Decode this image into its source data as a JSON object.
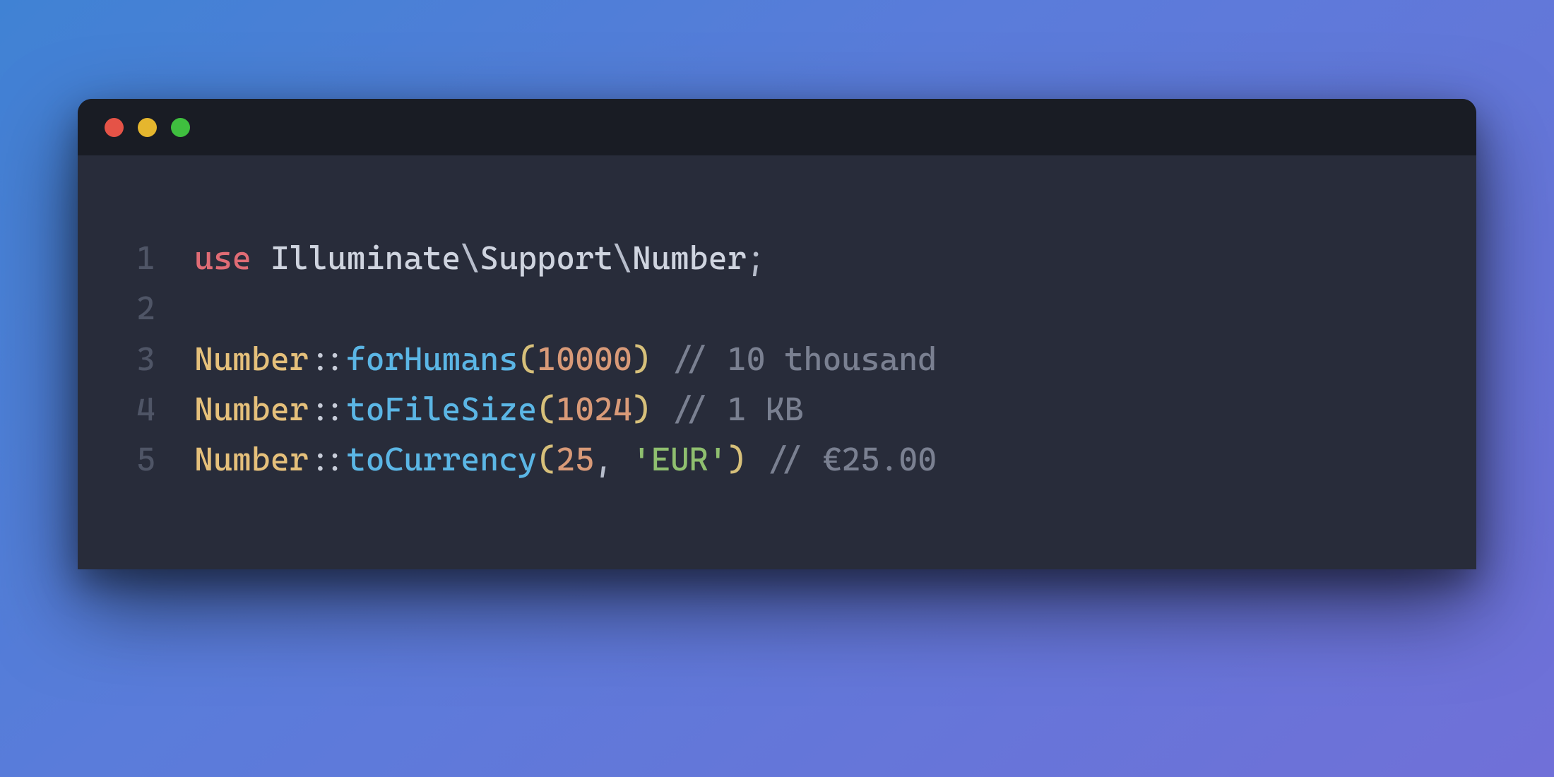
{
  "code": {
    "lines": [
      {
        "num": "1",
        "tokens": {
          "keyword": "use",
          "sp1": " ",
          "ns1": "Illuminate",
          "bs1": "\\",
          "ns2": "Support",
          "bs2": "\\",
          "ns3": "Number",
          "semi": ";"
        }
      },
      {
        "num": "2",
        "empty": ""
      },
      {
        "num": "3",
        "tokens": {
          "class": "Number",
          "scope": "::",
          "method": "forHumans",
          "open": "(",
          "arg1": "10000",
          "close": ")",
          "sp": " ",
          "comment": "// 10 thousand"
        }
      },
      {
        "num": "4",
        "tokens": {
          "class": "Number",
          "scope": "::",
          "method": "toFileSize",
          "open": "(",
          "arg1": "1024",
          "close": ")",
          "sp": " ",
          "comment": "// 1 KB"
        }
      },
      {
        "num": "5",
        "tokens": {
          "class": "Number",
          "scope": "::",
          "method": "toCurrency",
          "open": "(",
          "arg1": "25",
          "comma": ", ",
          "arg2": "'EUR'",
          "close": ")",
          "sp": " ",
          "comment": "// €25.00"
        }
      }
    ]
  }
}
